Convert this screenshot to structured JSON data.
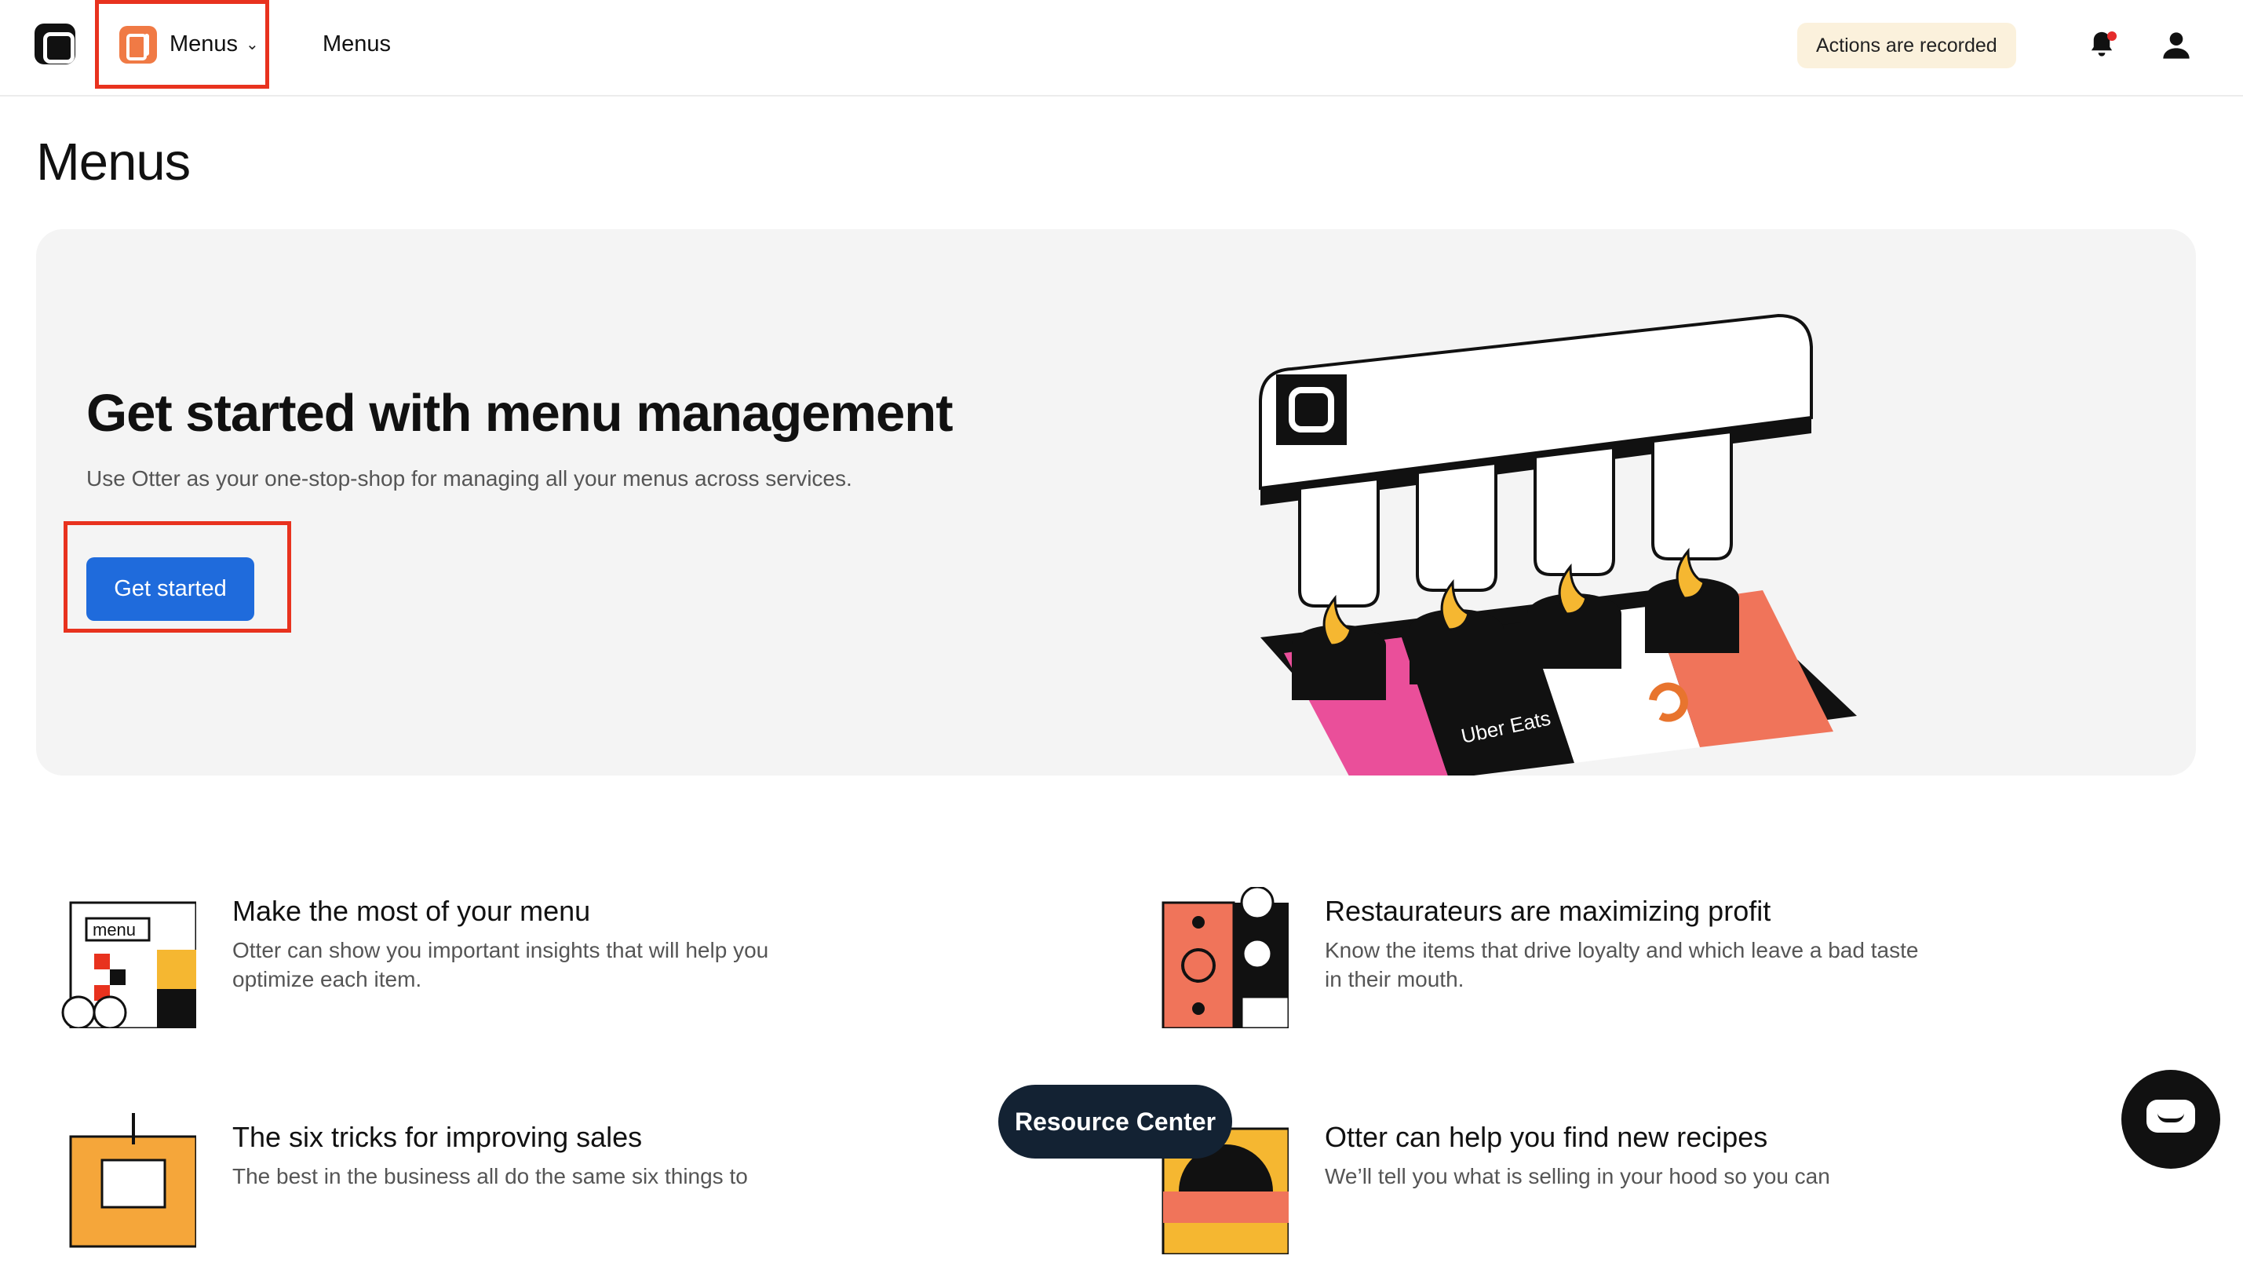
{
  "topbar": {
    "app_switcher_label": "Menus",
    "nav_link": "Menus",
    "recorded_badge": "Actions are recorded"
  },
  "page": {
    "title": "Menus"
  },
  "hero": {
    "title": "Get started with menu management",
    "subtitle": "Use Otter as your one-stop-shop for managing all your menus across services.",
    "cta_label": "Get started",
    "illustration_label": "Uber Eats"
  },
  "features": [
    {
      "title": "Make the most of your menu",
      "description": "Otter can show you important insights that will help you optimize each item.",
      "icon_text": "menu"
    },
    {
      "title": "Restaurateurs are maximizing profit",
      "description": "Know the items that drive loyalty and which leave a bad taste in their mouth."
    },
    {
      "title": "The six tricks for improving sales",
      "description": "The best in the business all do the same six things to"
    },
    {
      "title": "Otter can help you find new recipes",
      "description": "We’ll tell you what is selling in your hood so you can"
    }
  ],
  "floating": {
    "resource_center": "Resource Center"
  },
  "colors": {
    "accent_blue": "#1f6bdc",
    "highlight_red": "#e8321e",
    "app_orange": "#f07a45",
    "badge_bg": "#fbf1dc",
    "hero_bg": "#f4f4f4"
  }
}
